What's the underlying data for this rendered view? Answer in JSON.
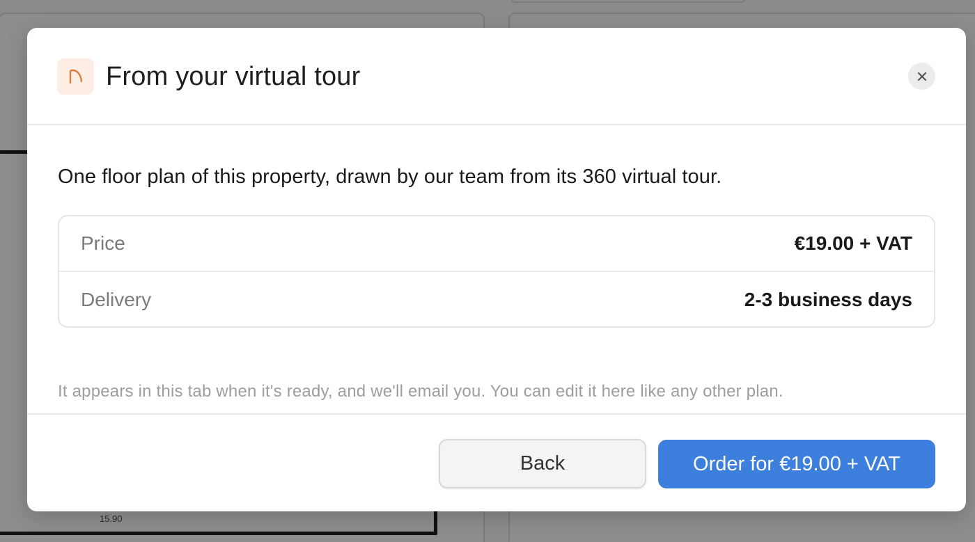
{
  "background": {
    "dimension_label": "15.90"
  },
  "modal": {
    "title": "From your virtual tour",
    "header_icon": "arc-doorway-icon",
    "accent_color": "#e07a3f",
    "close_icon": "close-icon",
    "intro": "One floor plan of this property, drawn by our team from its 360 virtual tour.",
    "details": [
      {
        "label": "Price",
        "value": "€19.00 + VAT"
      },
      {
        "label": "Delivery",
        "value": "2-3 business days"
      }
    ],
    "note": "It appears in this tab when it's ready, and we'll email you. You can edit it here like any other plan.",
    "buttons": {
      "back": "Back",
      "order": "Order for €19.00 + VAT",
      "order_color": "#3c7fdd"
    }
  }
}
